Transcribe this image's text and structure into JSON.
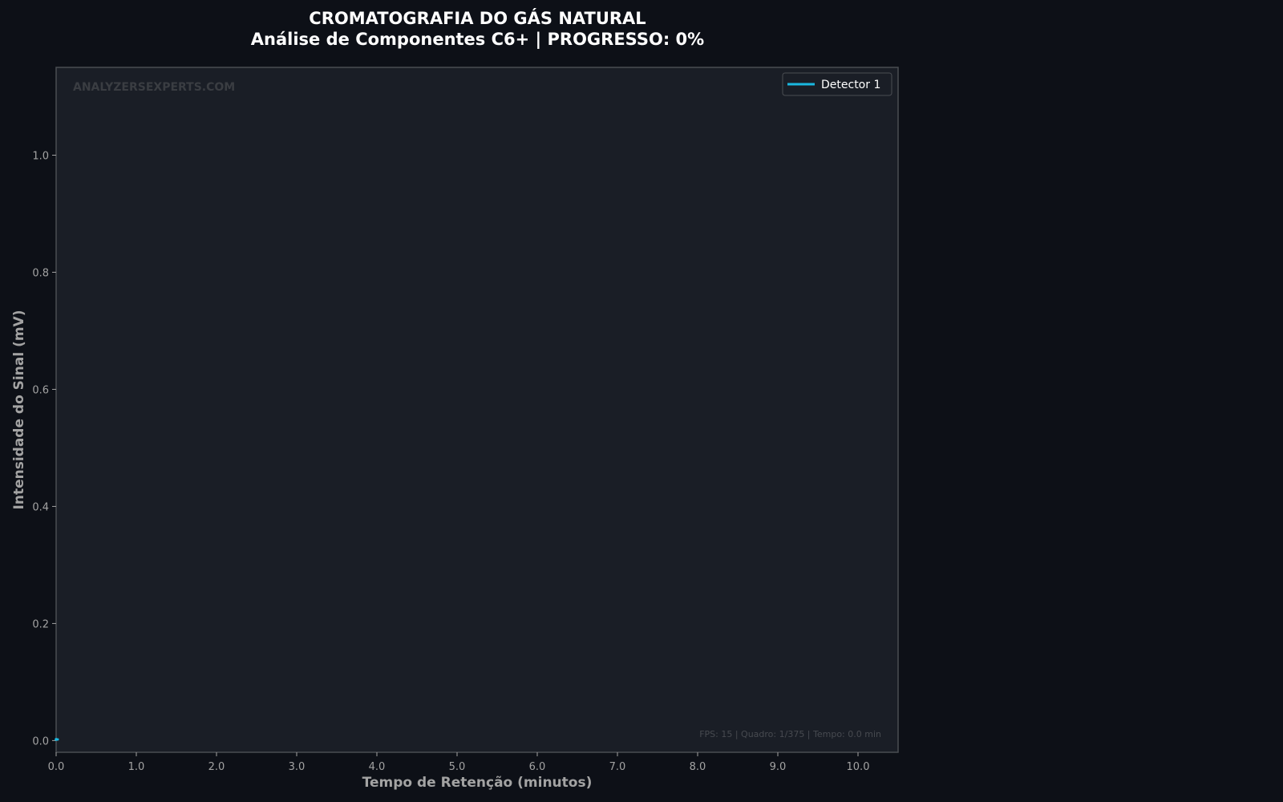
{
  "chart_data": {
    "type": "line",
    "title": "CROMATOGRAFIA DO GÁS NATURAL",
    "subtitle": "Análise de Componentes C6+  |  PROGRESSO: 0%",
    "progress_percent": 0,
    "xlabel": "Tempo de Retenção (minutos)",
    "ylabel": "Intensidade do Sinal (mV)",
    "xlim": [
      0,
      10.5
    ],
    "ylim": [
      -0.02,
      1.15
    ],
    "x_ticks": [
      0,
      1,
      2,
      3,
      4,
      5,
      6,
      7,
      8,
      9,
      10
    ],
    "x_tick_labels": [
      "0.0",
      "1.0",
      "2.0",
      "3.0",
      "4.0",
      "5.0",
      "6.0",
      "7.0",
      "8.0",
      "9.0",
      "10.0"
    ],
    "y_ticks": [
      0,
      0.2,
      0.4,
      0.6,
      0.8,
      1.0
    ],
    "y_tick_labels": [
      "0.0",
      "0.2",
      "0.4",
      "0.6",
      "0.8",
      "1.0"
    ],
    "grid": false,
    "legend_position": "top-right",
    "series": [
      {
        "name": "Detector 1",
        "color": "#1ab8e0",
        "x": [
          0.0,
          0.02
        ],
        "y": [
          0.002,
          0.002
        ]
      }
    ],
    "watermark": "ANALYZERSEXPERTS.COM",
    "info_text": "FPS: 15 | Quadro: 1/375 | Tempo: 0.0 min"
  },
  "colors": {
    "page_background": "#0d1017",
    "plot_background": "#1a1e26",
    "plot_border": "#4a4d52",
    "text": "#ffffff",
    "tick_text": "#a3a3a3"
  }
}
